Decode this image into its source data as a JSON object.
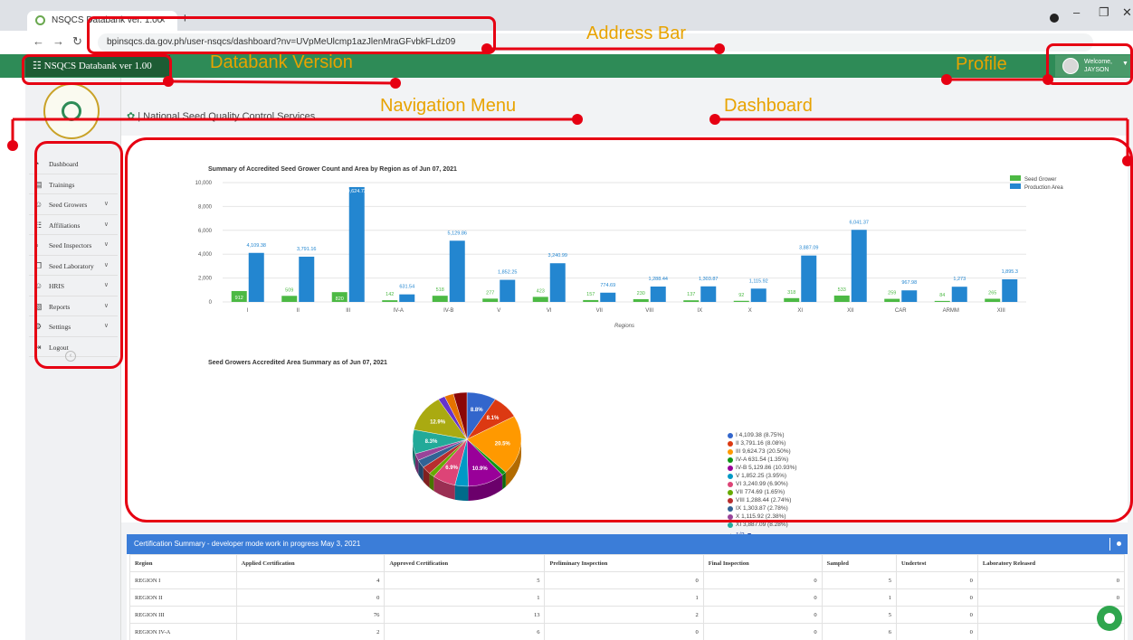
{
  "browser": {
    "tab_title": "NSQCS Databank ver. 1.00",
    "tab_close": "×",
    "new_tab": "+",
    "url": "bpinsqcs.da.gov.ph/user-nsqcs/dashboard?nv=UVpMeUlcmp1azJlenMraGFvbkFLdz09"
  },
  "app": {
    "brand": "NSQCS Databank ver 1.00",
    "profile_line1": "Welcome,",
    "profile_line2": "JAYSON",
    "page_title": "| National Seed Quality Control Services"
  },
  "sidebar": {
    "items": [
      {
        "label": "Dashboard",
        "icon": "dashboard-icon",
        "chevron": false
      },
      {
        "label": "Trainings",
        "icon": "book-icon",
        "chevron": false
      },
      {
        "label": "Seed Growers",
        "icon": "users-icon",
        "chevron": true
      },
      {
        "label": "Affiliations",
        "icon": "sitemap-icon",
        "chevron": true
      },
      {
        "label": "Seed Inspectors",
        "icon": "search-icon",
        "chevron": true
      },
      {
        "label": "Seed Laboratory",
        "icon": "copy-icon",
        "chevron": true
      },
      {
        "label": "HRIS",
        "icon": "users-icon",
        "chevron": true
      },
      {
        "label": "Reports",
        "icon": "file-icon",
        "chevron": true
      },
      {
        "label": "Settings",
        "icon": "gears-icon",
        "chevron": true
      },
      {
        "label": "Logout",
        "icon": "logout-icon",
        "chevron": false
      }
    ]
  },
  "annotations": {
    "address_bar": "Address Bar",
    "databank_version": "Databank Version",
    "profile": "Profile",
    "navigation_menu": "Navigation Menu",
    "dashboard": "Dashboard"
  },
  "chart_data": [
    {
      "type": "bar",
      "title": "Summary of Accredited Seed Grower Count and Area by Region as of Jun 07, 2021",
      "xlabel": "Regions",
      "ylabel": "",
      "ylim": [
        0,
        10000
      ],
      "yticks": [
        "0",
        "2,000",
        "4,000",
        "6,000",
        "8,000",
        "10,000"
      ],
      "categories": [
        "I",
        "II",
        "III",
        "IV-A",
        "IV-B",
        "V",
        "VI",
        "VII",
        "VIII",
        "IX",
        "X",
        "XI",
        "XII",
        "CAR",
        "ARMM",
        "XIII"
      ],
      "series": [
        {
          "name": "Seed Grower",
          "color": "#4cb944",
          "values": [
            912,
            509,
            820,
            142,
            518,
            277,
            423,
            157,
            230,
            137,
            92,
            318,
            533,
            259,
            84,
            265
          ],
          "labels": [
            "912",
            "509",
            "820",
            "142",
            "518",
            "277",
            "423",
            "157",
            "230",
            "137",
            "92",
            "318",
            "533",
            "259",
            "84",
            "265"
          ]
        },
        {
          "name": "Production Area",
          "color": "#2386d0",
          "values": [
            4109.38,
            3791.16,
            9624.73,
            631.54,
            5129.86,
            1852.25,
            3240.99,
            774.69,
            1288.44,
            1303.87,
            1115.92,
            3887.09,
            6041.37,
            967.98,
            1273,
            1895.3
          ],
          "labels": [
            "4,109.38",
            "3,791.16",
            "9,624.73",
            "631.54",
            "5,129.86",
            "1,852.25",
            "3,240.99",
            "774.69",
            "1,288.44",
            "1,303.87",
            "1,115.92",
            "3,887.09",
            "6,041.37",
            "967.98",
            "1,273",
            "1,895.3"
          ]
        }
      ],
      "legend": "top-right",
      "grid": true
    },
    {
      "type": "pie",
      "title": "Seed Growers Accredited Area Summary as of Jun 07, 2021",
      "slices": [
        {
          "label": "I",
          "value": 4109.38,
          "pct": "8.75%",
          "color": "#3366cc",
          "text": "I 4,109.38 (8.75%)"
        },
        {
          "label": "II",
          "value": 3791.16,
          "pct": "8.08%",
          "color": "#dc3912",
          "text": "II 3,791.16 (8.08%)"
        },
        {
          "label": "III",
          "value": 9624.73,
          "pct": "20.50%",
          "color": "#ff9900",
          "text": "III 9,624.73 (20.50%)"
        },
        {
          "label": "IV-A",
          "value": 631.54,
          "pct": "1.35%",
          "color": "#109618",
          "text": "IV-A 631.54 (1.35%)"
        },
        {
          "label": "IV-B",
          "value": 5129.86,
          "pct": "10.93%",
          "color": "#990099",
          "text": "IV-B 5,129.86 (10.93%)"
        },
        {
          "label": "V",
          "value": 1852.25,
          "pct": "3.95%",
          "color": "#0099c6",
          "text": "V 1,852.25 (3.95%)"
        },
        {
          "label": "VI",
          "value": 3240.99,
          "pct": "6.90%",
          "color": "#dd4477",
          "text": "VI 3,240.99 (6.90%)"
        },
        {
          "label": "VII",
          "value": 774.69,
          "pct": "1.65%",
          "color": "#66aa00",
          "text": "VII 774.69 (1.65%)"
        },
        {
          "label": "VIII",
          "value": 1288.44,
          "pct": "2.74%",
          "color": "#b82e2e",
          "text": "VIII 1,288.44 (2.74%)"
        },
        {
          "label": "IX",
          "value": 1303.87,
          "pct": "2.78%",
          "color": "#316395",
          "text": "IX 1,303.87 (2.78%)"
        },
        {
          "label": "X",
          "value": 1115.92,
          "pct": "2.38%",
          "color": "#994499",
          "text": "X 1,115.92 (2.38%)"
        },
        {
          "label": "XI",
          "value": 3887.09,
          "pct": "8.28%",
          "color": "#22aa99",
          "text": "XI 3,887.09 (8.28%)"
        },
        {
          "label": "XII",
          "value": 6041.37,
          "pct": "12.9%",
          "color": "#aaaa11"
        },
        {
          "label": "CAR",
          "value": 967.98,
          "color": "#6633cc"
        },
        {
          "label": "ARMM",
          "value": 1273,
          "color": "#e67300"
        },
        {
          "label": "XIII",
          "value": 1895.3,
          "color": "#8b0707"
        }
      ],
      "slice_labels": [
        "8.8%",
        "8.1%",
        "20.5%",
        "10.9%",
        "6.9%",
        "8.3%",
        "12.9%"
      ],
      "legend_page": "1/2"
    }
  ],
  "certification": {
    "title": "Certification Summary - developer mode work in progress May 3, 2021",
    "columns": [
      "Region",
      "Applied Certification",
      "Approved Certification",
      "Preliminary Inspection",
      "Final Inspection",
      "Sampled",
      "Undertest",
      "Laboratory Released"
    ],
    "rows": [
      [
        "REGION I",
        "4",
        "5",
        "0",
        "0",
        "5",
        "0",
        "0"
      ],
      [
        "REGION II",
        "0",
        "1",
        "1",
        "0",
        "1",
        "0",
        "0"
      ],
      [
        "REGION III",
        "76",
        "13",
        "2",
        "0",
        "5",
        "0",
        ""
      ],
      [
        "REGION IV-A",
        "2",
        "6",
        "0",
        "0",
        "6",
        "0",
        ""
      ]
    ]
  }
}
